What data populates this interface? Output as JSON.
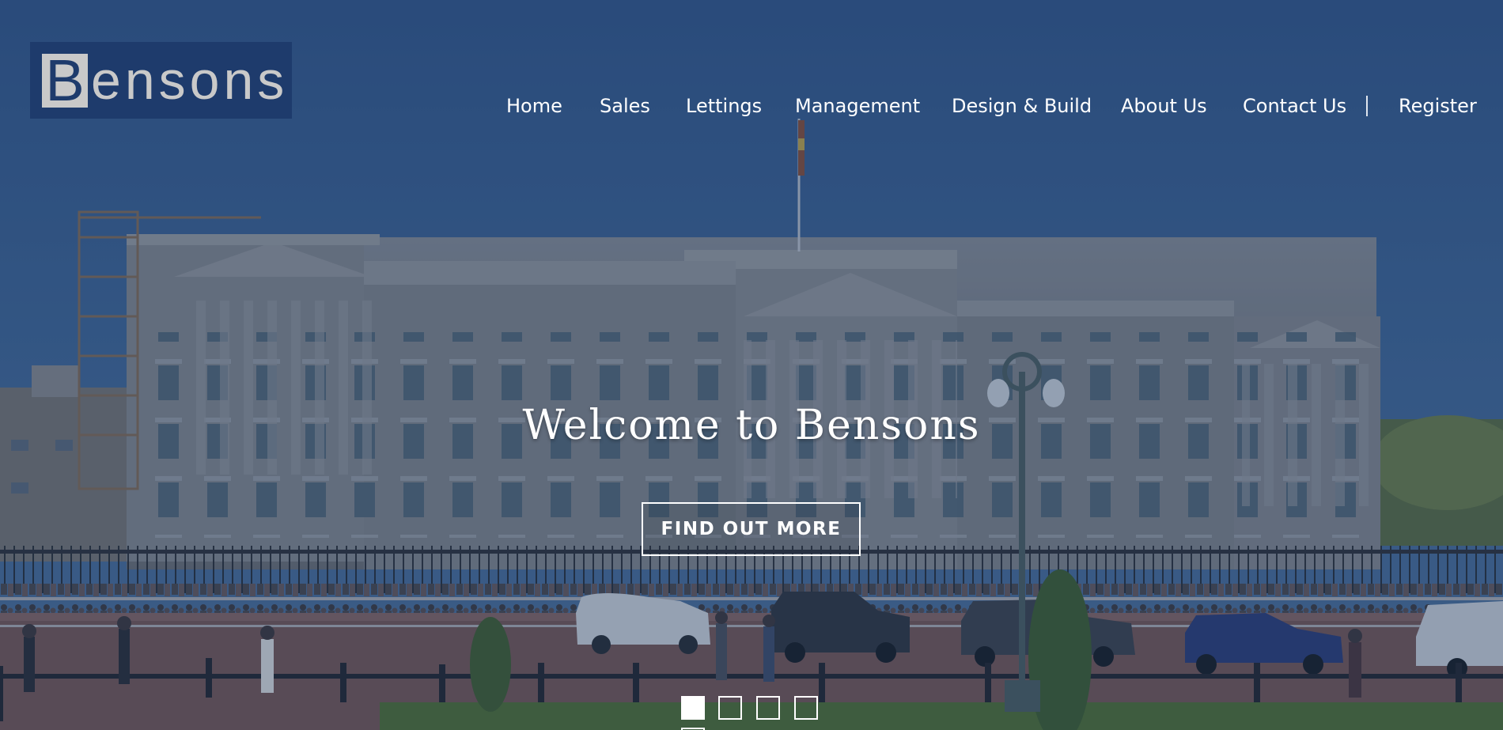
{
  "site": {
    "logo_letter": "B",
    "logo_rest": "ensons",
    "logo_text": "Bensons",
    "brand_color": "#1e3b6c"
  },
  "nav": {
    "items": [
      {
        "label": "Home"
      },
      {
        "label": "Sales"
      },
      {
        "label": "Lettings"
      },
      {
        "label": "Management"
      },
      {
        "label": "Design & Build"
      },
      {
        "label": "About Us"
      },
      {
        "label": "Contact Us"
      }
    ],
    "register_label": "Register"
  },
  "hero": {
    "headline": "Welcome to Bensons",
    "cta_label": "FIND OUT MORE"
  },
  "slider": {
    "slide_count": 5,
    "active_slide": 1
  },
  "colors": {
    "overlay": "#2f5183",
    "text": "#ffffff"
  }
}
